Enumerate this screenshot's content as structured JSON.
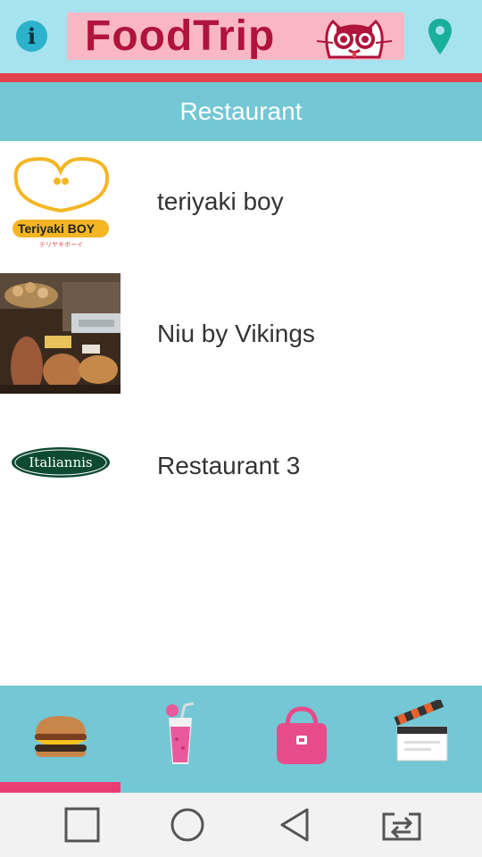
{
  "header": {
    "logo_text": "FoodTrip",
    "info_icon_glyph": "i"
  },
  "section": {
    "title": "Restaurant"
  },
  "restaurants": [
    {
      "name": "teriyaki boy",
      "logo_text": "Teriyaki BOY",
      "logo_subtext": "テリヤキボーイ"
    },
    {
      "name": "Niu by Vikings"
    },
    {
      "name": "Restaurant 3",
      "logo_text": "Italiannis"
    }
  ],
  "tabs": [
    {
      "icon": "burger-icon",
      "selected": true
    },
    {
      "icon": "drink-icon",
      "selected": false
    },
    {
      "icon": "handbag-icon",
      "selected": false
    },
    {
      "icon": "clapperboard-icon",
      "selected": false
    }
  ],
  "colors": {
    "top_bar": "#a7e2ef",
    "accent_red": "#e3414b",
    "header_teal": "#74c7d4",
    "tab_indicator": "#e83e74"
  }
}
